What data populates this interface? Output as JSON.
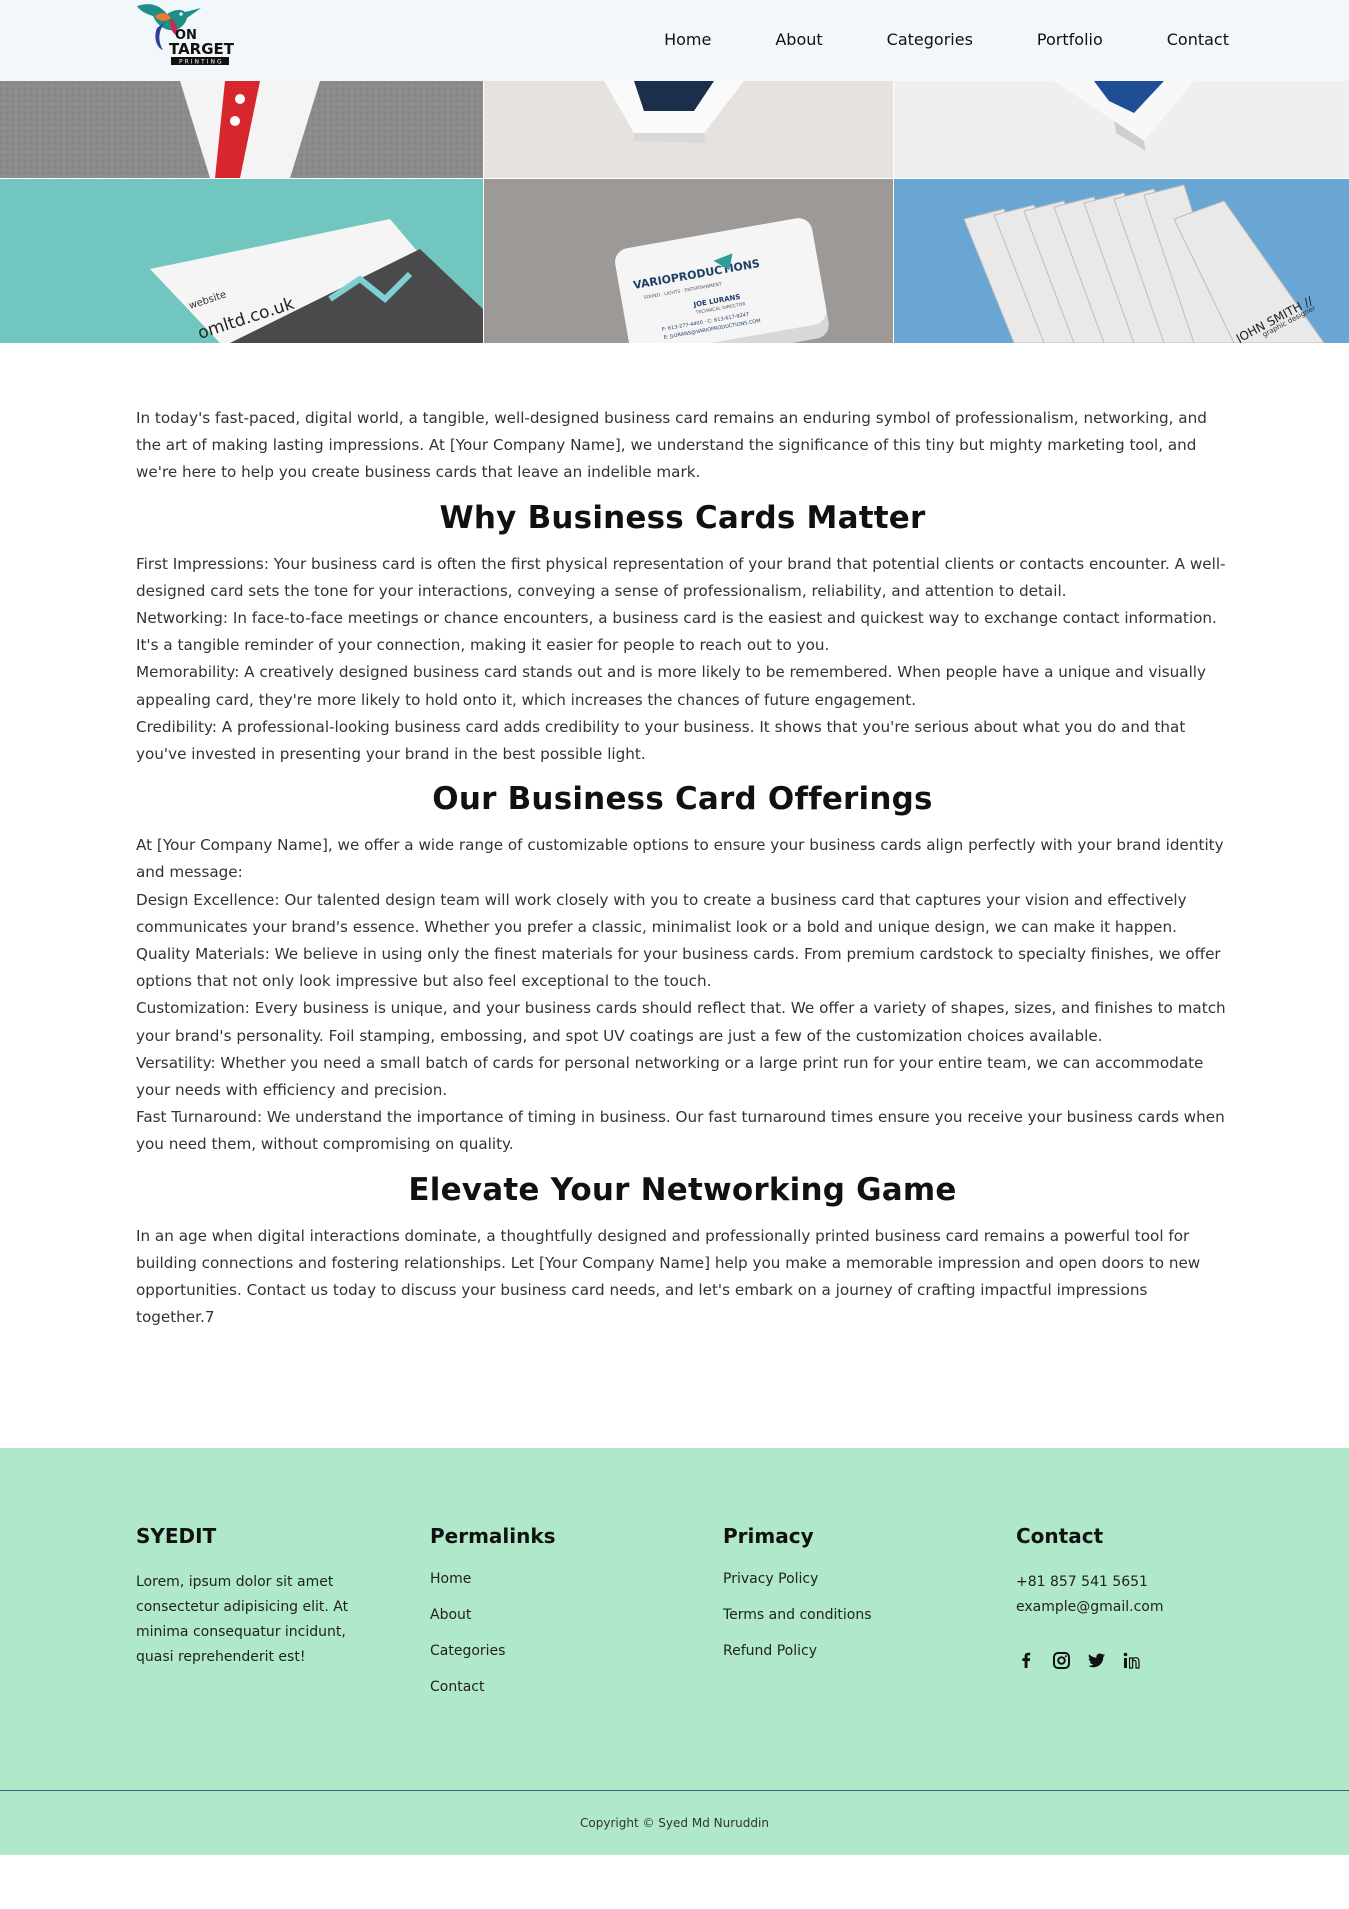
{
  "nav": {
    "logo_text_top": "ON",
    "logo_text_main": "TARGET",
    "logo_text_sub": "PRINTING",
    "links": [
      "Home",
      "About",
      "Categories",
      "Portfolio",
      "Contact"
    ]
  },
  "hero": {
    "card_text": {
      "website_label": "website",
      "website_value": "omltd.co.uk",
      "company": "VARIOPRODUCTIONS",
      "company_tagline": "SOUND · LIGHTS · ENTERTAINMENT",
      "person": "JOE LURANS",
      "role": "TECHNICAL DIRECTOR",
      "phone": "P: 613-277-4400 · C: 613-617-9247",
      "email": "E: JLURANS@VARIOPRODUCTIONS.COM",
      "name_right": "JOHN SMITH //",
      "role_right": "graphic designer"
    },
    "colors": {
      "gray_top_left": "#8d8d8d",
      "beige_top_mid": "#e6e2dd",
      "white_top_right": "#eef0f0",
      "teal": "#72c6c0",
      "gray_mid": "#9d9997",
      "blue": "#6aa6d3"
    }
  },
  "content": {
    "intro": "In today's fast-paced, digital world, a tangible, well-designed business card remains an enduring symbol of professionalism, networking, and the art of making lasting impressions. At [Your Company Name], we understand the significance of this tiny but mighty marketing tool, and we're here to help you create business cards that leave an indelible mark.",
    "section1_title": "Why Business Cards Matter",
    "section1_items": [
      "First Impressions: Your business card is often the first physical representation of your brand that potential clients or contacts encounter. A well-designed card sets the tone for your interactions, conveying a sense of professionalism, reliability, and attention to detail.",
      "Networking: In face-to-face meetings or chance encounters, a business card is the easiest and quickest way to exchange contact information. It's a tangible reminder of your connection, making it easier for people to reach out to you.",
      "Memorability: A creatively designed business card stands out and is more likely to be remembered. When people have a unique and visually appealing card, they're more likely to hold onto it, which increases the chances of future engagement.",
      "Credibility: A professional-looking business card adds credibility to your business. It shows that you're serious about what you do and that you've invested in presenting your brand in the best possible light."
    ],
    "section2_title": "Our Business Card Offerings",
    "section2_items": [
      "At [Your Company Name], we offer a wide range of customizable options to ensure your business cards align perfectly with your brand identity and message:",
      "Design Excellence: Our talented design team will work closely with you to create a business card that captures your vision and effectively communicates your brand's essence. Whether you prefer a classic, minimalist look or a bold and unique design, we can make it happen.",
      "Quality Materials: We believe in using only the finest materials for your business cards. From premium cardstock to specialty finishes, we offer options that not only look impressive but also feel exceptional to the touch.",
      "Customization: Every business is unique, and your business cards should reflect that. We offer a variety of shapes, sizes, and finishes to match your brand's personality. Foil stamping, embossing, and spot UV coatings are just a few of the customization choices available.",
      "Versatility: Whether you need a small batch of cards for personal networking or a large print run for your entire team, we can accommodate your needs with efficiency and precision.",
      "Fast Turnaround: We understand the importance of timing in business. Our fast turnaround times ensure you receive your business cards when you need them, without compromising on quality."
    ],
    "section3_title": "Elevate Your Networking Game",
    "section3_text": "In an age when digital interactions dominate, a thoughtfully designed and professionally printed business card remains a powerful tool for building connections and fostering relationships. Let [Your Company Name] help you make a memorable impression and open doors to new opportunities. Contact us today to discuss your business card needs, and let's embark on a journey of crafting impactful impressions together.7"
  },
  "footer": {
    "brand_title": "SYEDIT",
    "brand_desc": "Lorem, ipsum dolor sit amet consectetur adipisicing elit. At minima consequatur incidunt, quasi reprehenderit est!",
    "permalinks_title": "Permalinks",
    "permalinks": [
      "Home",
      "About",
      "Categories",
      "Contact"
    ],
    "primacy_title": "Primacy",
    "primacy_links": [
      "Privacy Policy",
      "Terms and conditions",
      "Refund Policy"
    ],
    "contact_title": "Contact",
    "phone": "+81 857 541 5651",
    "email": "example@gmail.com",
    "social_icons": [
      "facebook-icon",
      "instagram-icon",
      "twitter-icon",
      "linkedin-icon"
    ],
    "copyright": "Copyright © Syed Md Nuruddin",
    "bg_color": "#b0e8cc"
  }
}
